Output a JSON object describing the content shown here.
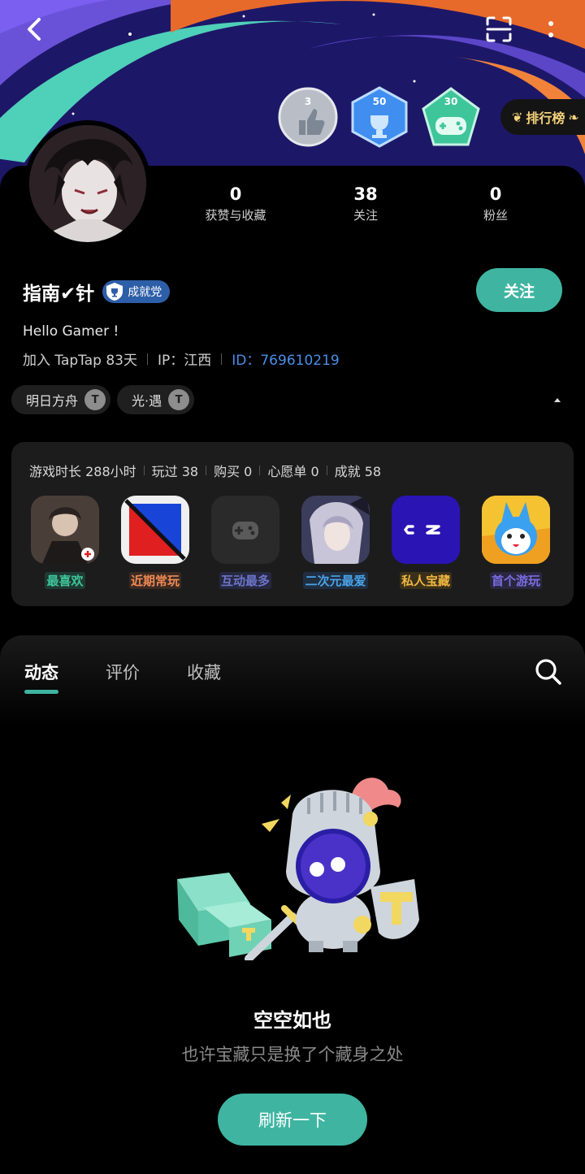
{
  "hero": {
    "badges": [
      {
        "value": "3",
        "color": "#9aa3b0"
      },
      {
        "value": "50",
        "color": "#3f8ef0"
      },
      {
        "value": "30",
        "color": "#3fc59a"
      }
    ],
    "rank_label": "排行榜"
  },
  "profile": {
    "stats": [
      {
        "value": "0",
        "label": "获赞与收藏"
      },
      {
        "value": "38",
        "label": "关注"
      },
      {
        "value": "0",
        "label": "粉丝"
      }
    ],
    "name": "指南✔针",
    "achievement_tag": "成就党",
    "follow_label": "关注",
    "bio": "Hello Gamer !",
    "join_text": "加入 TapTap 83天",
    "ip_text": "IP：江西",
    "id_text": "ID：769610219",
    "game_tags": [
      {
        "label": "明日方舟"
      },
      {
        "label": "光·遇"
      }
    ]
  },
  "games": {
    "stats": [
      "游戏时长 288小时",
      "玩过 38",
      "购买 0",
      "心愿单 0",
      "成就 58"
    ],
    "items": [
      {
        "label": "最喜欢",
        "color": "#3fc59a"
      },
      {
        "label": "近期常玩",
        "color": "#f08a55"
      },
      {
        "label": "互动最多",
        "color": "#6c74c9"
      },
      {
        "label": "二次元最爱",
        "color": "#4aa3e8"
      },
      {
        "label": "私人宝藏",
        "color": "#f0b640"
      },
      {
        "label": "首个游玩",
        "color": "#7a6ee0"
      }
    ]
  },
  "tabs": [
    "动态",
    "评价",
    "收藏"
  ],
  "empty": {
    "title": "空空如也",
    "subtitle": "也许宝藏只是换了个藏身之处",
    "refresh_label": "刷新一下"
  },
  "colors": {
    "accent": "#3fb5a1",
    "link": "#4b8ee8"
  }
}
